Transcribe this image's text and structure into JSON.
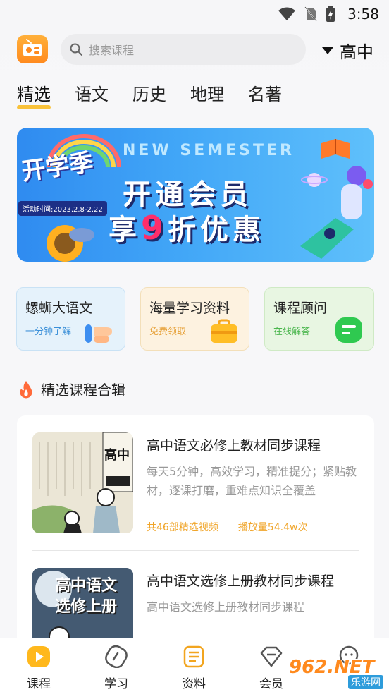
{
  "status_bar": {
    "time": "3:58"
  },
  "header": {
    "search_placeholder": "搜索课程",
    "grade": "高中"
  },
  "tabs": [
    {
      "label": "精选",
      "active": true
    },
    {
      "label": "语文",
      "active": false
    },
    {
      "label": "历史",
      "active": false
    },
    {
      "label": "地理",
      "active": false
    },
    {
      "label": "名著",
      "active": false
    }
  ],
  "banner": {
    "brand": "开学季",
    "subtitle": "NEW SEMESTER",
    "line1": "开通会员",
    "line2_prefix": "享",
    "line2_number": "9",
    "line2_suffix": "折优惠",
    "date": "活动时间:2023.2.8-2.22"
  },
  "features": [
    {
      "title": "螺蛳大语文",
      "subtitle": "一分钟了解"
    },
    {
      "title": "海量学习资料",
      "subtitle": "免费领取"
    },
    {
      "title": "课程顾问",
      "subtitle": "在线解答"
    }
  ],
  "section": {
    "title": "精选课程合辑"
  },
  "courses": [
    {
      "title": "高中语文必修上教材同步课程",
      "description": "每天5分钟，高效学习，精准提分；紧贴教材，逐课打磨，重难点知识全覆盖",
      "videos": "共46部精选视频",
      "plays": "播放量54.4w次",
      "thumb_text": "高中"
    },
    {
      "title": "高中语文选修上册教材同步课程",
      "description": "高中语文选修上册教材同步课程",
      "thumb_text_1": "高中语文",
      "thumb_text_2": "选修上册"
    }
  ],
  "bottom_nav": [
    {
      "label": "课程",
      "icon": "play-icon",
      "active": true
    },
    {
      "label": "学习",
      "icon": "pencil-icon",
      "active": false
    },
    {
      "label": "资料",
      "icon": "book-icon",
      "active": false
    },
    {
      "label": "会员",
      "icon": "diamond-icon",
      "active": false
    },
    {
      "label": "",
      "icon": "profile-icon",
      "active": false
    }
  ],
  "watermark": {
    "text": "962.NET",
    "subtext": "乐游网"
  },
  "colors": {
    "accent": "#f9c23a",
    "orange": "#ff8a1e"
  }
}
